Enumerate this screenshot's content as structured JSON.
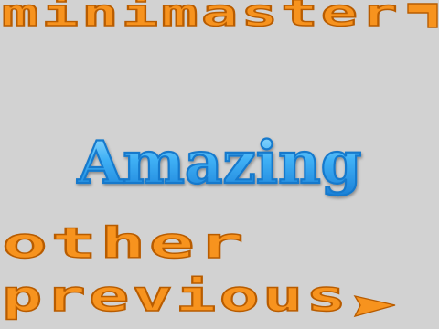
{
  "header": {
    "title": "minimaster"
  },
  "banner": {
    "text": "Amazing"
  },
  "menu": {
    "other_label": "other",
    "previous_label": "previous"
  },
  "icons": {
    "header_end": "corner-bracket-icon",
    "previous_arrow": "arrow-right-icon"
  },
  "colors": {
    "background": "#d2d2d2",
    "accent_orange": "#f7931e",
    "accent_orange_dark": "#b85c00",
    "banner_blue": "#36a8f0",
    "banner_blue_dark": "#1479cc"
  }
}
